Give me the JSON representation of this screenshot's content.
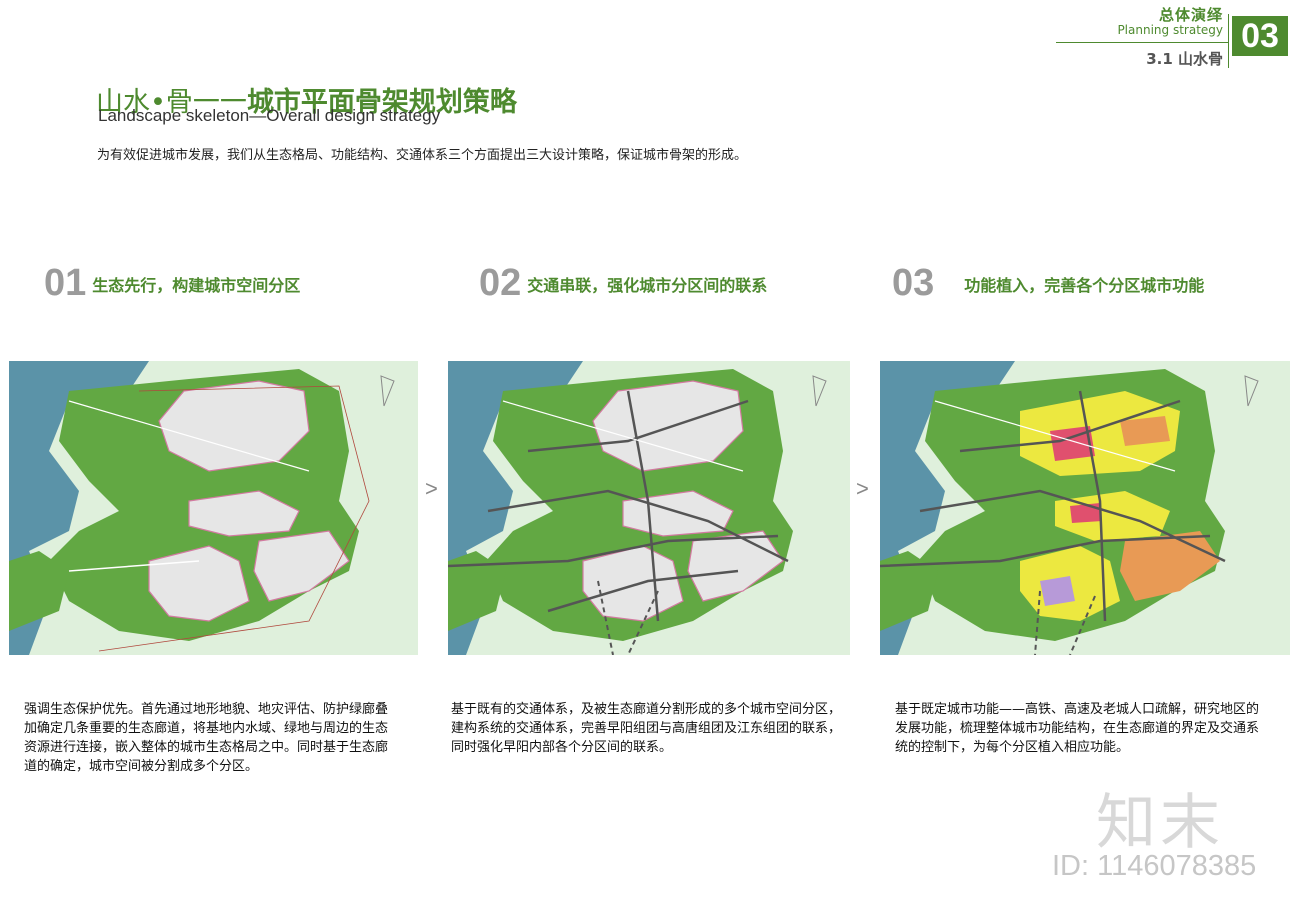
{
  "header": {
    "section_cn": "总体演绎",
    "section_en": "Planning strategy",
    "chapter_number": "03",
    "subsection": "3.1 山水骨"
  },
  "title": {
    "prefix_cn": "山水•骨一一",
    "main_cn": "城市平面骨架规划策略",
    "en": "Landscape  skeleton—Overall design strategy"
  },
  "intro": "为有效促进城市发展，我们从生态格局、功能结构、交通体系三个方面提出三大设计策略，保证城市骨架的形成。",
  "steps": [
    {
      "number": "01",
      "title": "生态先行，构建城市空间分区",
      "description": "强调生态保护优先。首先通过地形地貌、地灾评估、防护绿廊叠加确定几条重要的生态廊道，将基地内水域、绿地与周边的生态资源进行连接，嵌入整体的城市生态格局之中。同时基于生态廊道的确定，城市空间被分割成多个分区。"
    },
    {
      "number": "02",
      "title": "交通串联，强化城市分区间的联系",
      "description": "基于既有的交通体系，及被生态廊道分割形成的多个城市空间分区，建构系统的交通体系，完善早阳组团与高唐组团及江东组团的联系，同时强化早阳内部各个分区间的联系。"
    },
    {
      "number": "03",
      "title": "功能植入，完善各个分区城市功能",
      "description": "基于既定城市功能——高铁、高速及老城人口疏解，研究地区的发展功能，梳理整体城市功能结构，在生态廊道的界定及交通系统的控制下，为每个分区植入相应功能。"
    }
  ],
  "arrows": [
    ">",
    ">"
  ],
  "colors": {
    "accent_green": "#4e8a2f",
    "map_bg": "#dff0dc",
    "water": "#5b93a8",
    "green_land": "#62a843",
    "built_zone": "#e6e6e6",
    "residential": "#ece840",
    "commercial": "#e0506e",
    "industrial": "#e89a55",
    "public": "#b79ad8"
  },
  "watermark": {
    "logo": "知末",
    "id": "ID: 1146078385"
  }
}
